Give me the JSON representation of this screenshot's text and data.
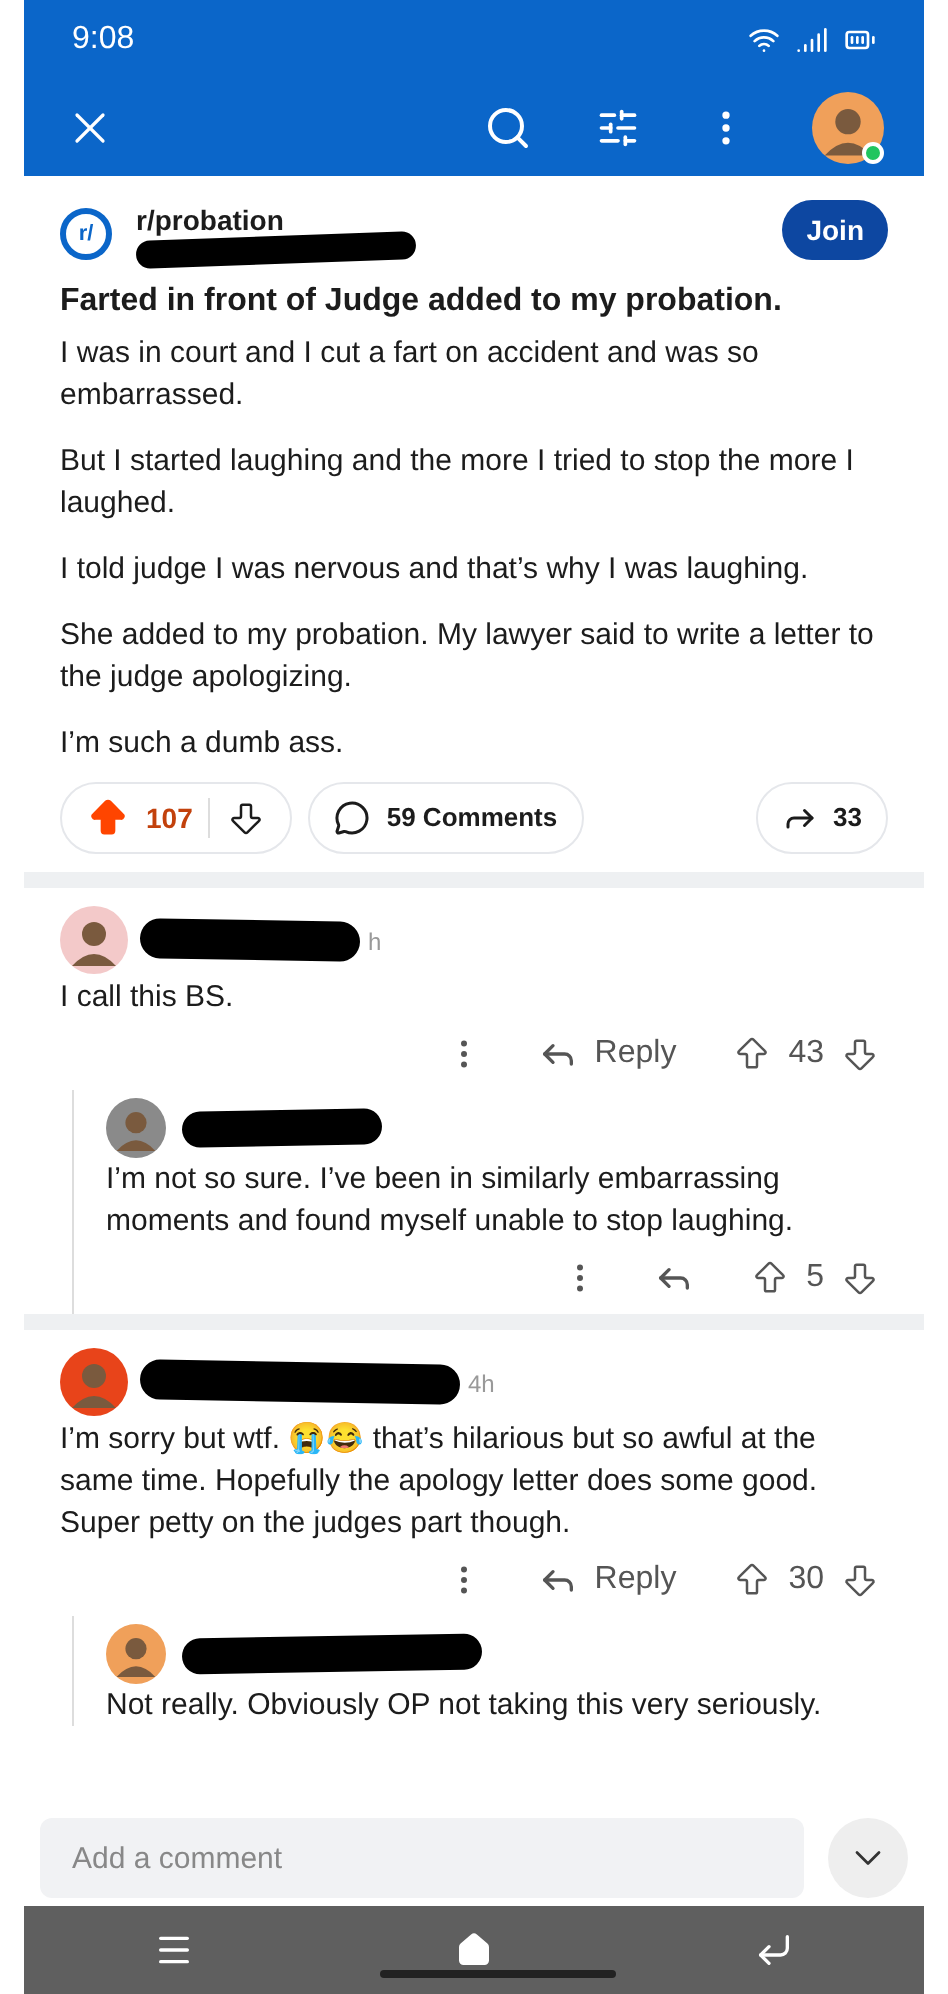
{
  "status_bar": {
    "time": "9:08"
  },
  "header": {
    "online": true
  },
  "post": {
    "icon": "r/",
    "subreddit": "r/probation",
    "join": "Join",
    "title": "Farted in front of Judge added to my probation.",
    "paragraphs": [
      "I was in court and I cut a fart on accident and was so embarrassed.",
      "But I started laughing and the more I tried to stop the more I laughed.",
      "I told judge I was nervous and that’s why I was laughing.",
      "She added to my probation. My lawyer said to write a letter to the judge apologizing.",
      "I’m such a dumb ass."
    ],
    "votes": {
      "score": "107",
      "upvoted": true
    },
    "comments": "59 Comments",
    "shares": "33"
  },
  "comments": [
    {
      "time": "h",
      "color": "#f3c9c9",
      "body": "I call this BS.",
      "reply": "Reply",
      "score": "43",
      "children": [
        {
          "color": "#8a8a8a",
          "body": "I’m not so sure. I’ve been in similarly embarrassing moments and found myself unable to stop laughing.",
          "score": "5"
        }
      ]
    },
    {
      "time": "4h",
      "color": "#e8441a",
      "body": "I’m sorry but wtf. 😭😂 that’s hilarious but so awful at the same time. Hopefully the apology letter does some good. Super petty on the judges part though.",
      "reply": "Reply",
      "score": "30",
      "children": [
        {
          "color": "#f0a05a",
          "body": "Not really. Obviously OP not taking this very seriously."
        }
      ]
    }
  ],
  "composer": {
    "placeholder": "Add a comment"
  }
}
